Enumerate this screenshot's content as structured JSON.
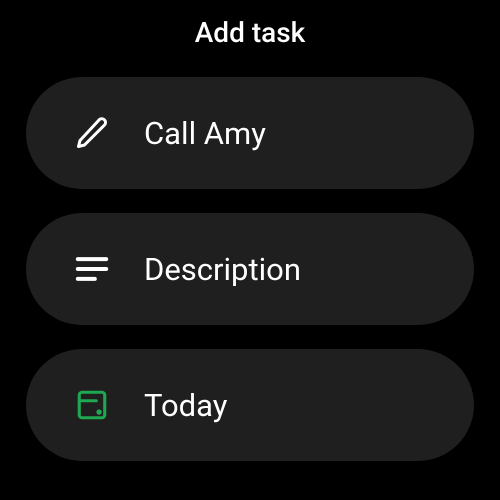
{
  "header": {
    "title": "Add task"
  },
  "items": [
    {
      "label": "Call Amy",
      "icon": "pencil-icon"
    },
    {
      "label": "Description",
      "icon": "lines-icon"
    },
    {
      "label": "Today",
      "icon": "calendar-icon"
    }
  ],
  "colors": {
    "background": "#000000",
    "item_bg": "#1f1f1f",
    "text": "#ffffff",
    "accent": "#1ea852"
  }
}
